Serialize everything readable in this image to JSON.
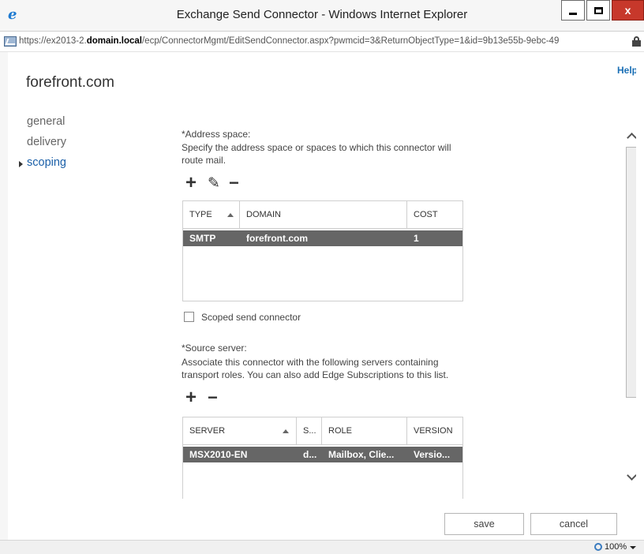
{
  "window": {
    "title": "Exchange Send Connector - Windows Internet Explorer",
    "close_glyph": "x"
  },
  "address_bar": {
    "url_scheme": "https://",
    "url_subdomain": "ex2013-2.",
    "url_host": "domain.local",
    "url_path": "/ecp/ConnectorMgmt/EditSendConnector.aspx?pwmcid=3&ReturnObjectType=1&id=9b13e55b-9ebc-49"
  },
  "page": {
    "title": "forefront.com",
    "help_label": "Help"
  },
  "nav": {
    "items": [
      {
        "label": "general"
      },
      {
        "label": "delivery"
      },
      {
        "label": "scoping"
      }
    ],
    "active": "scoping"
  },
  "address_space": {
    "heading": "*Address space:",
    "description_line1": "Specify the address space or spaces to which this connector will",
    "description_line2": "route mail.",
    "toolbar": {
      "add": "+",
      "edit": "✎",
      "remove": "−"
    },
    "columns": {
      "type": "TYPE",
      "domain": "DOMAIN",
      "cost": "COST"
    },
    "rows": [
      {
        "type": "SMTP",
        "domain": "forefront.com",
        "cost": "1"
      }
    ]
  },
  "scoped": {
    "label": "Scoped send connector",
    "checked": false
  },
  "source_server": {
    "heading": "*Source server:",
    "description_line1": "Associate this connector with the following servers containing",
    "description_line2": "transport roles. You can also add Edge Subscriptions to this list.",
    "toolbar": {
      "add": "+",
      "remove": "−"
    },
    "columns": {
      "server": "SERVER",
      "site": "S...",
      "role": "ROLE",
      "version": "VERSION"
    },
    "rows": [
      {
        "server": "MSX2010-EN",
        "site": "d...",
        "role": "Mailbox, Clie...",
        "version": "Versio..."
      }
    ]
  },
  "buttons": {
    "save": "save",
    "cancel": "cancel"
  },
  "status_bar": {
    "zoom": "100%"
  },
  "colors": {
    "accent": "#1a5fa8",
    "selected_row": "#666666",
    "close_button": "#c7382b"
  }
}
